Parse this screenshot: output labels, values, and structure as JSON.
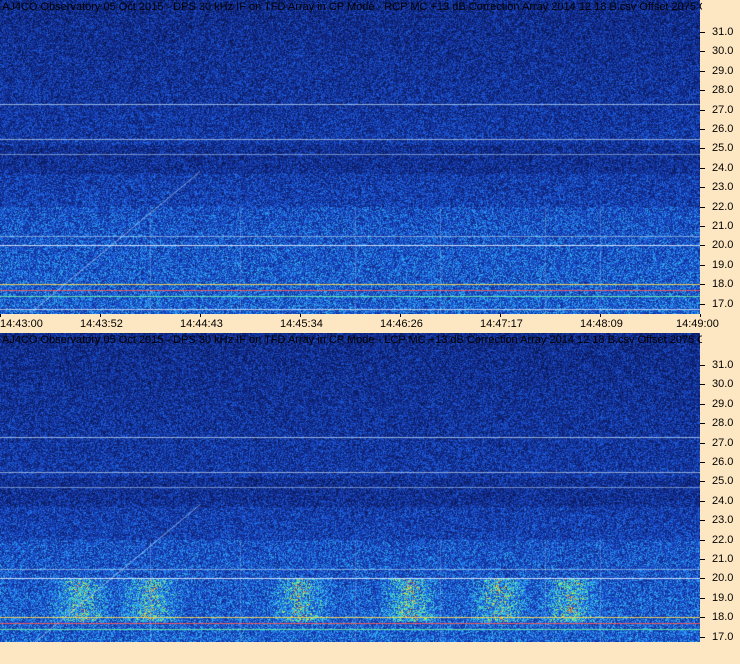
{
  "panels": [
    {
      "title": "AJ4CO Observatory 05 Oct 2015 - DPS 30 kHz IF on TFD Array in CP Mode - RCP  MC +13 dB  Correction Array 2014 12 18 B.csv  Offset 2075  Gain 5.0",
      "freq_labels": [
        "31.0",
        "30.0",
        "29.0",
        "28.0",
        "27.0",
        "26.0",
        "25.0",
        "24.0",
        "23.0",
        "22.0",
        "21.0",
        "20.0",
        "19.0",
        "18.0",
        "17.0"
      ],
      "time_labels": [
        "14:43:00",
        "14:43:52",
        "14:44:43",
        "14:45:34",
        "14:46:26",
        "14:47:17",
        "14:48:09",
        "14:49:00"
      ],
      "polarization": "RCP"
    },
    {
      "title": "AJ4CO Observatory 05 Oct 2015 - DPS 30 kHz IF on TFD Array in CP Mode - LCP  MC +13 dB  Correction Array 2014 12 18 B.csv  Offset 2075  Gain 5.0",
      "freq_labels": [
        "31.0",
        "30.0",
        "29.0",
        "28.0",
        "27.0",
        "26.0",
        "25.0",
        "24.0",
        "23.0",
        "22.0",
        "21.0",
        "20.0",
        "19.0",
        "18.0",
        "17.0"
      ],
      "time_labels": [],
      "polarization": "LCP"
    }
  ],
  "colors": {
    "background": "#fde7c2",
    "spectrogram_base": "#0b1f7a"
  }
}
